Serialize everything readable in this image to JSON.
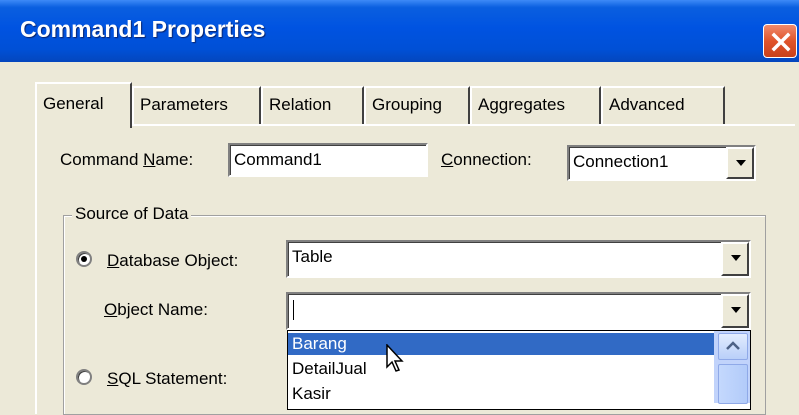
{
  "window": {
    "title": "Command1 Properties",
    "close_icon": "close-x-icon",
    "titlebar_color": "#0054e3",
    "close_color": "#e0542b"
  },
  "tabs": [
    {
      "label": "General",
      "active": true
    },
    {
      "label": "Parameters",
      "active": false
    },
    {
      "label": "Relation",
      "active": false
    },
    {
      "label": "Grouping",
      "active": false
    },
    {
      "label": "Aggregates",
      "active": false
    },
    {
      "label": "Advanced",
      "active": false
    }
  ],
  "general": {
    "command_name_label": "Command Name:",
    "command_name_mnemonic": "N",
    "command_name_value": "Command1",
    "connection_label": "Connection:",
    "connection_mnemonic": "C",
    "connection_value": "Connection1"
  },
  "source_of_data": {
    "title": "Source of Data",
    "database_object_label": "Database Object:",
    "database_object_mnemonic": "D",
    "database_object_selected": true,
    "database_object_value": "Table",
    "object_name_label": "Object Name:",
    "object_name_mnemonic": "O",
    "object_name_value": "",
    "sql_statement_label": "SQL Statement:",
    "sql_statement_mnemonic": "S",
    "sql_statement_selected": false
  },
  "object_name_dropdown": {
    "items": [
      "Barang",
      "DetailJual",
      "Kasir"
    ],
    "selected": "Barang",
    "selection_color": "#316ac5"
  }
}
